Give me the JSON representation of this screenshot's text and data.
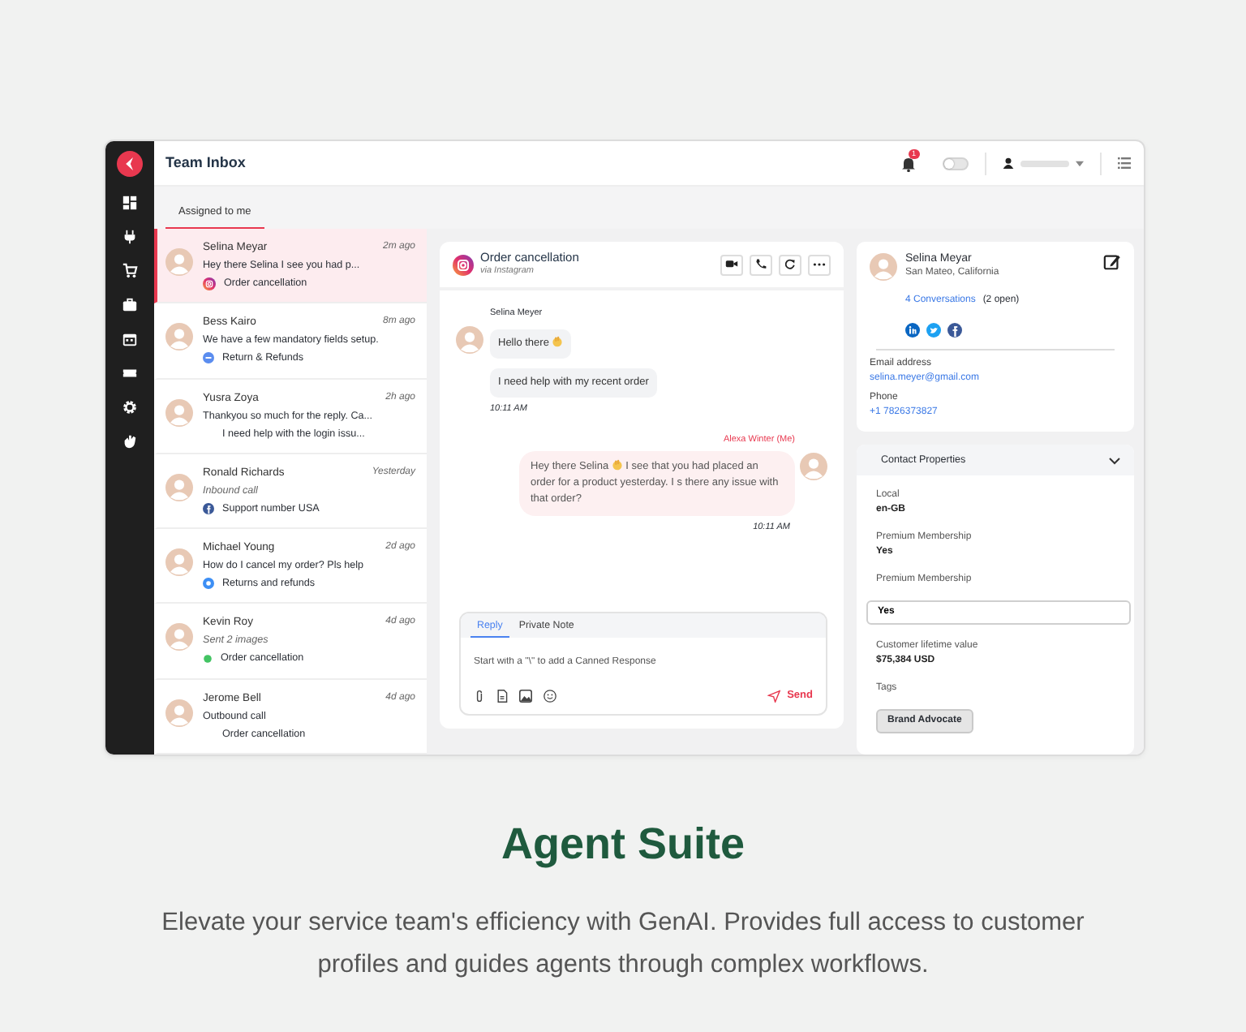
{
  "window": {
    "title": "Team Inbox",
    "notification_count": "1",
    "toggle": {
      "on": false
    }
  },
  "tabs": [
    {
      "label": "Assigned to me",
      "selected": true
    }
  ],
  "conversations": [
    {
      "name": "Selina Meyar",
      "time": "2m ago",
      "preview": "Hey there Selina   I see you had p...",
      "preview_italic": false,
      "channel": {
        "kind": "instagram",
        "label": "Order cancellation"
      },
      "selected": true
    },
    {
      "name": "Bess Kairo",
      "time": "8m ago",
      "preview": "We have a few mandatory fields setup.",
      "preview_italic": false,
      "channel": {
        "kind": "web",
        "label": "Return & Refunds"
      },
      "selected": false
    },
    {
      "name": "Yusra Zoya",
      "time": "2h ago",
      "preview": "Thankyou so much for the reply. Ca...",
      "preview_italic": false,
      "channel": {
        "kind": "none",
        "label": "I need help with the login issu..."
      },
      "selected": false
    },
    {
      "name": "Ronald Richards",
      "time": "Yesterday",
      "preview": "Inbound call",
      "preview_italic": true,
      "channel": {
        "kind": "facebook",
        "label": "Support number USA"
      },
      "selected": false
    },
    {
      "name": "Michael Young",
      "time": "2d ago",
      "preview": "How do I cancel my order? Pls help",
      "preview_italic": false,
      "channel": {
        "kind": "chat",
        "label": "Returns and refunds"
      },
      "selected": false
    },
    {
      "name": "Kevin Roy",
      "time": "4d ago",
      "preview": "Sent 2 images",
      "preview_italic": true,
      "channel": {
        "kind": "whatsapp",
        "label": "Order cancellation"
      },
      "selected": false
    },
    {
      "name": "Jerome Bell",
      "time": "4d ago",
      "preview": "Outbound call",
      "preview_italic": false,
      "channel": {
        "kind": "none",
        "label": "Order cancellation"
      },
      "selected": false
    }
  ],
  "chat": {
    "title": "Order cancellation",
    "subtitle": "via Instagram",
    "messages": [
      {
        "kind": "incoming",
        "sender": "Selina Meyer",
        "time": "10:11 AM",
        "bubbles": [
          {
            "text": "Hello there",
            "wave": true
          },
          {
            "text": "I need help with my recent order",
            "wave": false
          }
        ]
      },
      {
        "kind": "outgoing",
        "sender": "Alexa Winter (Me)",
        "time": "10:11 AM",
        "bubbles": [
          {
            "text": "Hey there Selina",
            "wave": true,
            "text_after": "I see that you had placed an order for a product yesterday. I s there any issue with that order?"
          }
        ]
      }
    ],
    "composer": {
      "tabs": [
        {
          "label": "Reply",
          "selected": true
        },
        {
          "label": "Private Note",
          "selected": false
        }
      ],
      "placeholder": "Start with a \"\\\" to add a Canned Response",
      "send": "Send"
    }
  },
  "contact": {
    "name": "Selina Meyar",
    "location": "San Mateo, California",
    "conversations": "4 Conversations",
    "open": "(2 open)",
    "email_label": "Email address",
    "email": "selina.meyer@gmail.com",
    "phone_label": "Phone",
    "phone": "+1 7826373827"
  },
  "properties": {
    "title": "Contact Properties",
    "expanded": true,
    "fields": [
      {
        "kind": "text",
        "label": "Local",
        "value": "en-GB"
      },
      {
        "kind": "text",
        "label": "Premium Membership",
        "value": "Yes"
      },
      {
        "kind": "input",
        "label": "Premium Membership",
        "value": "Yes"
      },
      {
        "kind": "text",
        "label": "Customer lifetime value",
        "value": "$75,384 USD"
      },
      {
        "kind": "tag",
        "label": "Tags",
        "value": "Brand Advocate"
      }
    ]
  },
  "promo": {
    "heading": "Agent Suite",
    "text": "Elevate your service team's efficiency with GenAI. Provides full access to customer profiles and guides agents through complex workflows."
  }
}
